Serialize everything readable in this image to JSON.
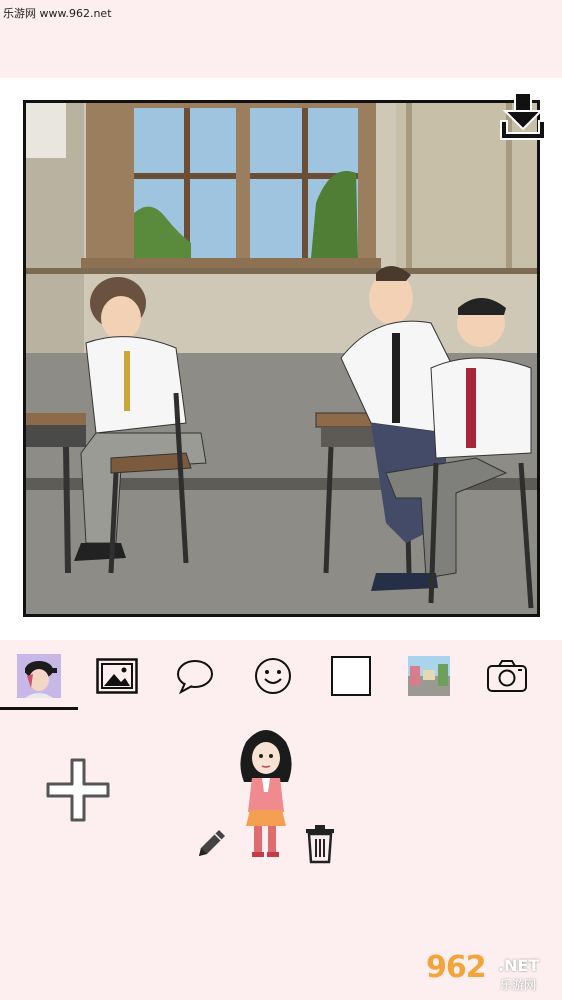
{
  "header": {
    "watermark_text": "乐游网 www.962.net"
  },
  "canvas": {
    "download_icon": "download-icon"
  },
  "toolbar": {
    "tools": [
      {
        "name": "character",
        "icon": "character-avatar-icon",
        "active": true
      },
      {
        "name": "background",
        "icon": "image-icon",
        "active": false
      },
      {
        "name": "speech-bubble",
        "icon": "speech-bubble-icon",
        "active": false
      },
      {
        "name": "emoji",
        "icon": "smiley-icon",
        "active": false
      },
      {
        "name": "frame",
        "icon": "square-frame-icon",
        "active": false
      },
      {
        "name": "scene",
        "icon": "scene-thumbnail-icon",
        "active": false
      },
      {
        "name": "camera",
        "icon": "camera-icon",
        "active": false
      }
    ]
  },
  "panel": {
    "add_icon": "plus-icon",
    "edit_icon": "pencil-icon",
    "delete_icon": "trash-icon"
  },
  "logo": {
    "big": "962",
    "net": ".NET",
    "sub": "乐游网"
  },
  "colors": {
    "panel_bg": "#fdeef0",
    "frame_border": "#111111",
    "logo_orange": "#f3a43a"
  }
}
